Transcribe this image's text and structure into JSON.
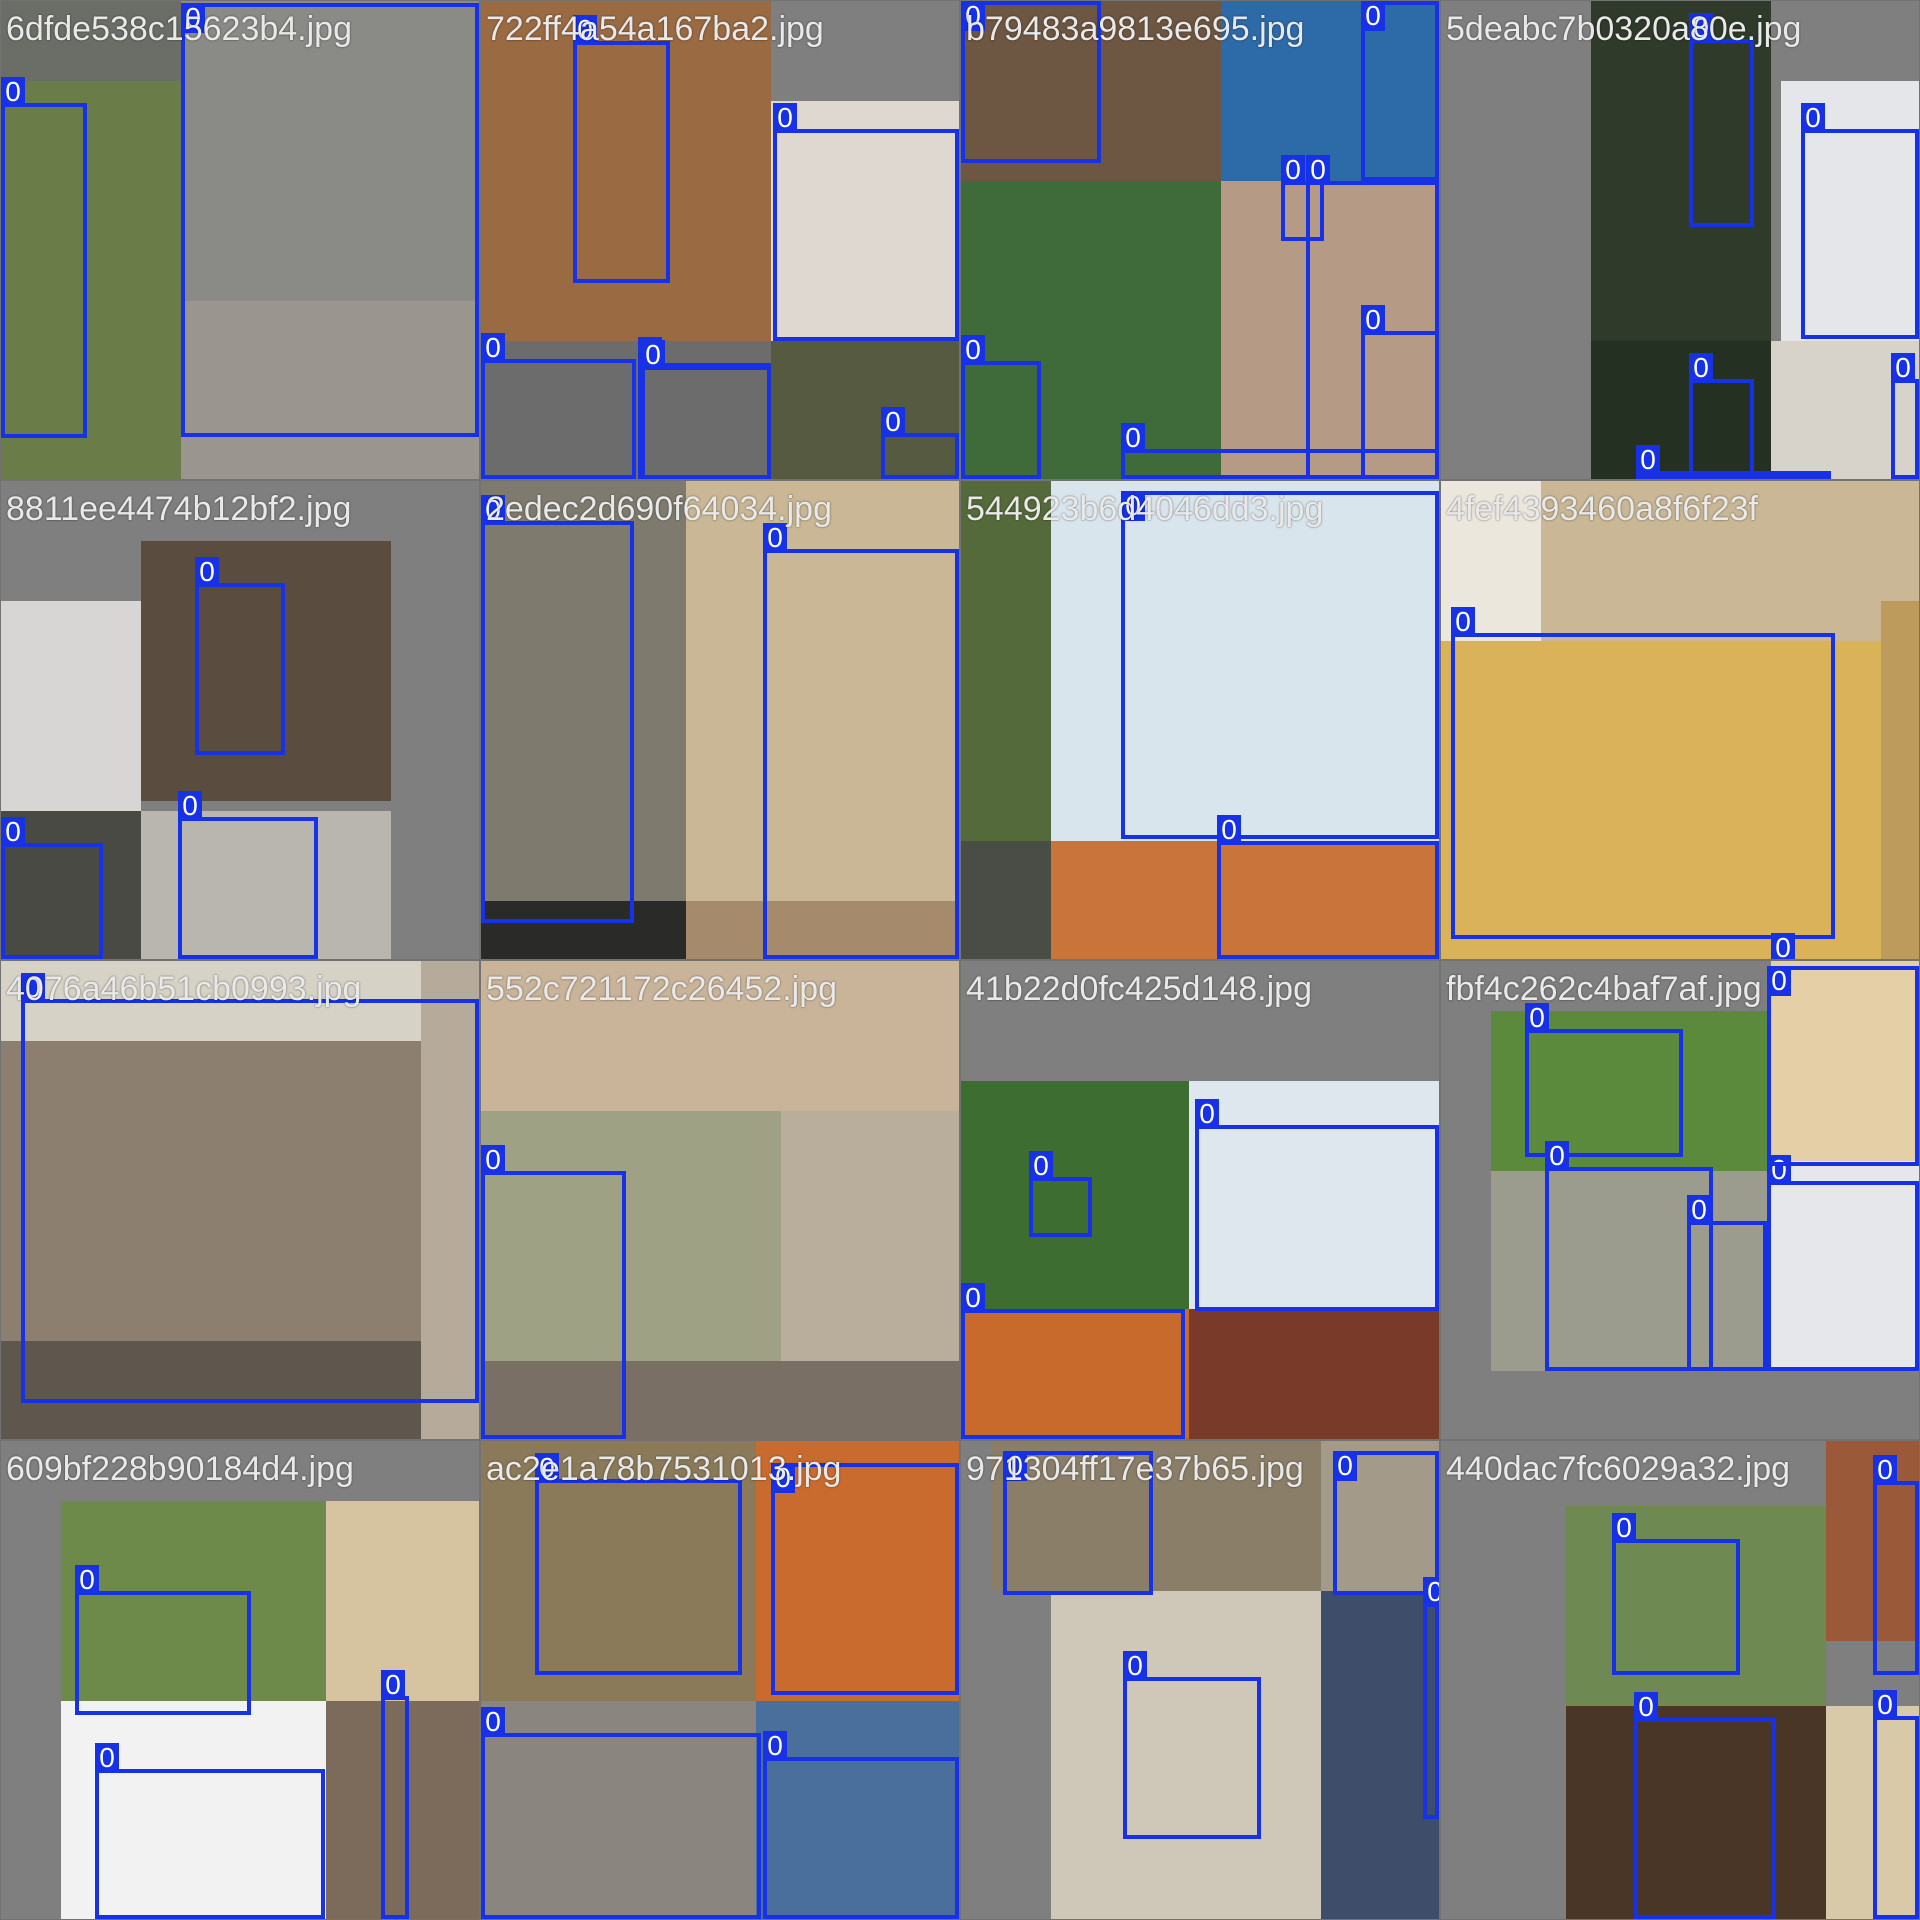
{
  "app": {
    "title": ""
  },
  "palette": {
    "background": "#727272",
    "box_color": "#1631e6",
    "label_text_color": "#ffffff",
    "title_text_color": "#e9e9e9"
  },
  "mosaic": {
    "tiles": [
      {
        "title": "6dfde538c15623b4.jpg",
        "boxes": [
          {
            "cls": "0"
          },
          {
            "cls": "0"
          }
        ],
        "region_colors": [
          "#6b6e66",
          "#6a7d48",
          "#8a8a86",
          "#9a968f"
        ]
      },
      {
        "title": "722ff4a54a167ba2.jpg",
        "boxes": [
          {
            "cls": "0"
          },
          {
            "cls": "0"
          },
          {
            "cls": "0"
          },
          {
            "cls": "0"
          },
          {
            "cls": "0"
          },
          {
            "cls": "0"
          }
        ],
        "region_colors": [
          "#9a6a43",
          "#ded8d0",
          "#6c6c6c",
          "#555a40"
        ]
      },
      {
        "title": "b79483a9813e695.jpg",
        "boxes": [
          {
            "cls": "0"
          },
          {
            "cls": "0"
          },
          {
            "cls": "0"
          },
          {
            "cls": "0"
          },
          {
            "cls": "0"
          },
          {
            "cls": "0"
          },
          {
            "cls": "0"
          }
        ],
        "region_colors": [
          "#6d5642",
          "#2d6aa8",
          "#3f6a3a",
          "#b59a86"
        ]
      },
      {
        "title": "5deabc7b0320a80e.jpg",
        "boxes": [
          {
            "cls": "0"
          },
          {
            "cls": "0"
          },
          {
            "cls": "0"
          },
          {
            "cls": "0"
          },
          {
            "cls": "0"
          }
        ],
        "region_colors": [
          "#2f3a2a",
          "#e4e6ea",
          "#233022",
          "#d8d3ca"
        ]
      },
      {
        "title": "8811ee4474b12bf2.jpg",
        "boxes": [
          {
            "cls": "0"
          },
          {
            "cls": "0"
          },
          {
            "cls": "0"
          }
        ],
        "region_colors": [
          "#5b4c40",
          "#d8d6d4",
          "#4a4a44",
          "#b9b6b0"
        ]
      },
      {
        "title": "2edec2d690f64034.jpg",
        "boxes": [
          {
            "cls": "0"
          },
          {
            "cls": "0"
          }
        ],
        "region_colors": [
          "#7e7b6e",
          "#c9b795",
          "#2a2a28",
          "#a58a6c"
        ]
      },
      {
        "title": "544923b6d4046dd3.jpg",
        "boxes": [
          {
            "cls": "0"
          },
          {
            "cls": "0"
          }
        ],
        "region_colors": [
          "#556a3a",
          "#d9e5ec",
          "#c8743a",
          "#4a4c46"
        ]
      },
      {
        "title": "4fef4393460a8f6f23f",
        "boxes": [
          {
            "cls": "0"
          },
          {
            "cls": "0"
          }
        ],
        "region_colors": [
          "#c9b796",
          "#d9b25a",
          "#bd9b5d",
          "#ece7dd"
        ]
      },
      {
        "title": "4076a46b51cb0993.jpg",
        "boxes": [
          {
            "cls": "0"
          }
        ],
        "region_colors": [
          "#8c7f70",
          "#d7d2c6",
          "#5f564d",
          "#b6ab9b"
        ]
      },
      {
        "title": "552c721172c26452.jpg",
        "boxes": [
          {
            "cls": "0"
          }
        ],
        "region_colors": [
          "#c9b49a",
          "#9fa185",
          "#7a6f64",
          "#b9ae9c"
        ]
      },
      {
        "title": "41b22d0fc425d148.jpg",
        "boxes": [
          {
            "cls": "0"
          },
          {
            "cls": "0"
          },
          {
            "cls": "0"
          }
        ],
        "region_colors": [
          "#3d6d30",
          "#dfe7ee",
          "#c76a2c",
          "#7a3a2a"
        ]
      },
      {
        "title": "fbf4c262c4baf7af.jpg",
        "boxes": [
          {
            "cls": "0"
          },
          {
            "cls": "0"
          },
          {
            "cls": "0"
          },
          {
            "cls": "0"
          },
          {
            "cls": "0"
          }
        ],
        "region_colors": [
          "#5b8a3c",
          "#e4cfa6",
          "#9b9b8e",
          "#e5e7ea"
        ]
      },
      {
        "title": "609bf228b90184d4.jpg",
        "boxes": [
          {
            "cls": "0"
          },
          {
            "cls": "0"
          },
          {
            "cls": "0"
          }
        ],
        "region_colors": [
          "#6d8a4b",
          "#d6c4a0",
          "#f2f2f2",
          "#7c6a5a"
        ]
      },
      {
        "title": "ac2e1a78b7531013.jpg",
        "boxes": [
          {
            "cls": "0"
          },
          {
            "cls": "0"
          },
          {
            "cls": "0"
          },
          {
            "cls": "0"
          }
        ],
        "region_colors": [
          "#8a7a5a",
          "#c96b2f",
          "#8b8580",
          "#4a6f9c"
        ]
      },
      {
        "title": "971304ff17e37b65.jpg",
        "boxes": [
          {
            "cls": "0"
          },
          {
            "cls": "0"
          },
          {
            "cls": "0"
          },
          {
            "cls": "0"
          }
        ],
        "region_colors": [
          "#8a7e68",
          "#a39a8a",
          "#cfc8b8",
          "#3e4d6a"
        ]
      },
      {
        "title": "440dac7fc6029a32.jpg",
        "boxes": [
          {
            "cls": "0"
          },
          {
            "cls": "0"
          },
          {
            "cls": "0"
          },
          {
            "cls": "0"
          }
        ],
        "region_colors": [
          "#6e8a52",
          "#9a5a3a",
          "#4a3626",
          "#d8c9a9"
        ]
      }
    ]
  }
}
